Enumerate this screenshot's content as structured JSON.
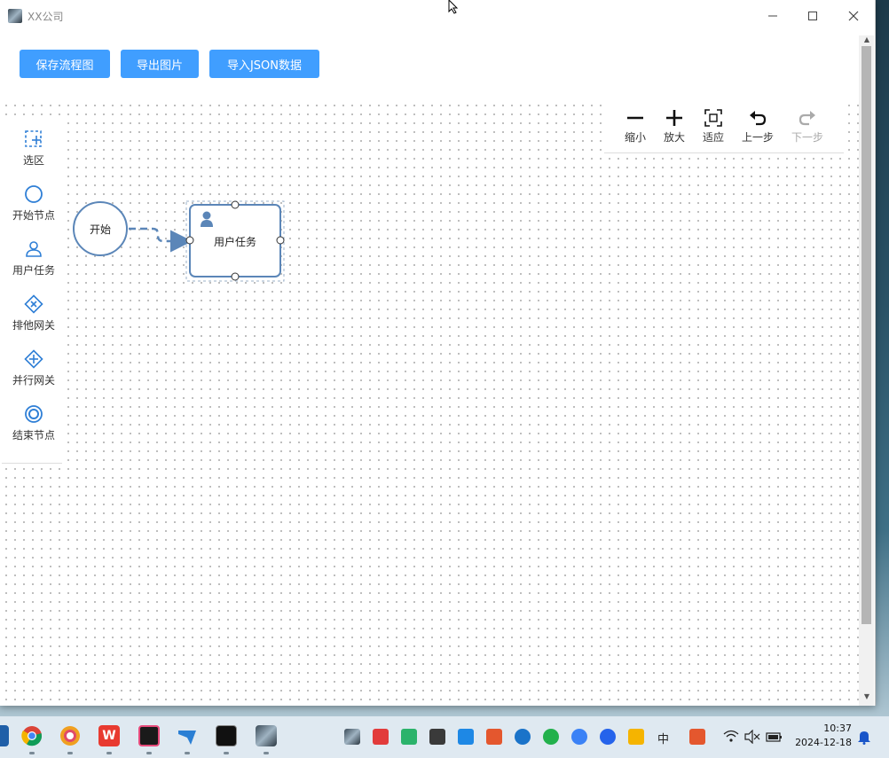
{
  "window": {
    "title": "XX公司"
  },
  "toolbar": {
    "save_label": "保存流程图",
    "export_label": "导出图片",
    "import_label": "导入JSON数据"
  },
  "palette": {
    "items": [
      {
        "label": "选区",
        "icon": "selection-icon"
      },
      {
        "label": "开始节点",
        "icon": "circle-icon"
      },
      {
        "label": "用户任务",
        "icon": "user-icon"
      },
      {
        "label": "排他网关",
        "icon": "exclusive-gateway-icon"
      },
      {
        "label": "并行网关",
        "icon": "parallel-gateway-icon"
      },
      {
        "label": "结束节点",
        "icon": "end-circle-icon"
      }
    ]
  },
  "controls": {
    "items": [
      {
        "label": "缩小",
        "icon": "zoom-out-icon",
        "enabled": true
      },
      {
        "label": "放大",
        "icon": "zoom-in-icon",
        "enabled": true
      },
      {
        "label": "适应",
        "icon": "fit-icon",
        "enabled": true
      },
      {
        "label": "上一步",
        "icon": "undo-icon",
        "enabled": true
      },
      {
        "label": "下一步",
        "icon": "redo-icon",
        "enabled": false
      }
    ]
  },
  "diagram": {
    "start_node_label": "开始",
    "task_node_label": "用户任务"
  },
  "colors": {
    "accent": "#409eff",
    "node_stroke": "#5b86b8",
    "palette_icon": "#2f7fd6"
  },
  "taskbar": {
    "time": "10:37",
    "date": "2024-12-18",
    "ime_label": "中"
  }
}
